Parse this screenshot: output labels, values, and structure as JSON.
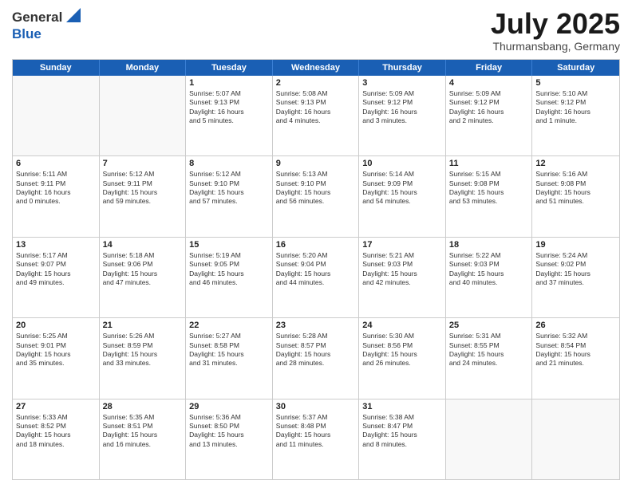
{
  "logo": {
    "general": "General",
    "blue": "Blue"
  },
  "title": "July 2025",
  "location": "Thurmansbang, Germany",
  "days": [
    "Sunday",
    "Monday",
    "Tuesday",
    "Wednesday",
    "Thursday",
    "Friday",
    "Saturday"
  ],
  "weeks": [
    [
      {
        "day": "",
        "info": ""
      },
      {
        "day": "",
        "info": ""
      },
      {
        "day": "1",
        "info": "Sunrise: 5:07 AM\nSunset: 9:13 PM\nDaylight: 16 hours\nand 5 minutes."
      },
      {
        "day": "2",
        "info": "Sunrise: 5:08 AM\nSunset: 9:13 PM\nDaylight: 16 hours\nand 4 minutes."
      },
      {
        "day": "3",
        "info": "Sunrise: 5:09 AM\nSunset: 9:12 PM\nDaylight: 16 hours\nand 3 minutes."
      },
      {
        "day": "4",
        "info": "Sunrise: 5:09 AM\nSunset: 9:12 PM\nDaylight: 16 hours\nand 2 minutes."
      },
      {
        "day": "5",
        "info": "Sunrise: 5:10 AM\nSunset: 9:12 PM\nDaylight: 16 hours\nand 1 minute."
      }
    ],
    [
      {
        "day": "6",
        "info": "Sunrise: 5:11 AM\nSunset: 9:11 PM\nDaylight: 16 hours\nand 0 minutes."
      },
      {
        "day": "7",
        "info": "Sunrise: 5:12 AM\nSunset: 9:11 PM\nDaylight: 15 hours\nand 59 minutes."
      },
      {
        "day": "8",
        "info": "Sunrise: 5:12 AM\nSunset: 9:10 PM\nDaylight: 15 hours\nand 57 minutes."
      },
      {
        "day": "9",
        "info": "Sunrise: 5:13 AM\nSunset: 9:10 PM\nDaylight: 15 hours\nand 56 minutes."
      },
      {
        "day": "10",
        "info": "Sunrise: 5:14 AM\nSunset: 9:09 PM\nDaylight: 15 hours\nand 54 minutes."
      },
      {
        "day": "11",
        "info": "Sunrise: 5:15 AM\nSunset: 9:08 PM\nDaylight: 15 hours\nand 53 minutes."
      },
      {
        "day": "12",
        "info": "Sunrise: 5:16 AM\nSunset: 9:08 PM\nDaylight: 15 hours\nand 51 minutes."
      }
    ],
    [
      {
        "day": "13",
        "info": "Sunrise: 5:17 AM\nSunset: 9:07 PM\nDaylight: 15 hours\nand 49 minutes."
      },
      {
        "day": "14",
        "info": "Sunrise: 5:18 AM\nSunset: 9:06 PM\nDaylight: 15 hours\nand 47 minutes."
      },
      {
        "day": "15",
        "info": "Sunrise: 5:19 AM\nSunset: 9:05 PM\nDaylight: 15 hours\nand 46 minutes."
      },
      {
        "day": "16",
        "info": "Sunrise: 5:20 AM\nSunset: 9:04 PM\nDaylight: 15 hours\nand 44 minutes."
      },
      {
        "day": "17",
        "info": "Sunrise: 5:21 AM\nSunset: 9:03 PM\nDaylight: 15 hours\nand 42 minutes."
      },
      {
        "day": "18",
        "info": "Sunrise: 5:22 AM\nSunset: 9:03 PM\nDaylight: 15 hours\nand 40 minutes."
      },
      {
        "day": "19",
        "info": "Sunrise: 5:24 AM\nSunset: 9:02 PM\nDaylight: 15 hours\nand 37 minutes."
      }
    ],
    [
      {
        "day": "20",
        "info": "Sunrise: 5:25 AM\nSunset: 9:01 PM\nDaylight: 15 hours\nand 35 minutes."
      },
      {
        "day": "21",
        "info": "Sunrise: 5:26 AM\nSunset: 8:59 PM\nDaylight: 15 hours\nand 33 minutes."
      },
      {
        "day": "22",
        "info": "Sunrise: 5:27 AM\nSunset: 8:58 PM\nDaylight: 15 hours\nand 31 minutes."
      },
      {
        "day": "23",
        "info": "Sunrise: 5:28 AM\nSunset: 8:57 PM\nDaylight: 15 hours\nand 28 minutes."
      },
      {
        "day": "24",
        "info": "Sunrise: 5:30 AM\nSunset: 8:56 PM\nDaylight: 15 hours\nand 26 minutes."
      },
      {
        "day": "25",
        "info": "Sunrise: 5:31 AM\nSunset: 8:55 PM\nDaylight: 15 hours\nand 24 minutes."
      },
      {
        "day": "26",
        "info": "Sunrise: 5:32 AM\nSunset: 8:54 PM\nDaylight: 15 hours\nand 21 minutes."
      }
    ],
    [
      {
        "day": "27",
        "info": "Sunrise: 5:33 AM\nSunset: 8:52 PM\nDaylight: 15 hours\nand 18 minutes."
      },
      {
        "day": "28",
        "info": "Sunrise: 5:35 AM\nSunset: 8:51 PM\nDaylight: 15 hours\nand 16 minutes."
      },
      {
        "day": "29",
        "info": "Sunrise: 5:36 AM\nSunset: 8:50 PM\nDaylight: 15 hours\nand 13 minutes."
      },
      {
        "day": "30",
        "info": "Sunrise: 5:37 AM\nSunset: 8:48 PM\nDaylight: 15 hours\nand 11 minutes."
      },
      {
        "day": "31",
        "info": "Sunrise: 5:38 AM\nSunset: 8:47 PM\nDaylight: 15 hours\nand 8 minutes."
      },
      {
        "day": "",
        "info": ""
      },
      {
        "day": "",
        "info": ""
      }
    ]
  ]
}
